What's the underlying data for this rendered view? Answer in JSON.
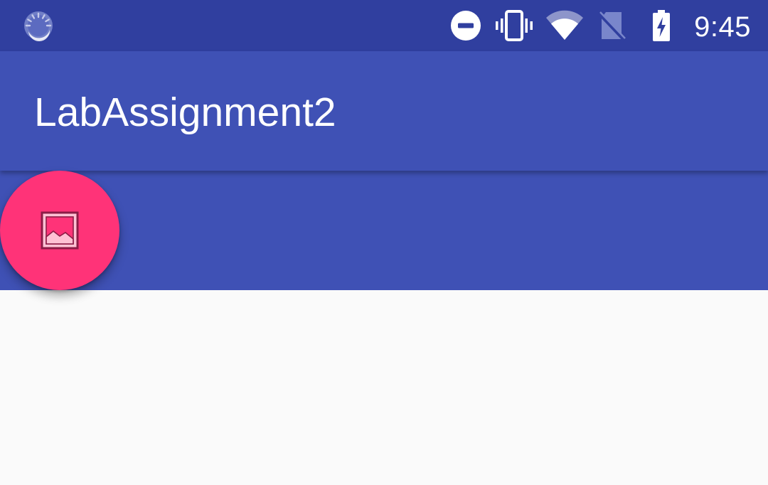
{
  "status_bar": {
    "time": "9:45",
    "icons": [
      "loading-spinner-icon",
      "do-not-disturb-icon",
      "vibrate-icon",
      "wifi-icon",
      "no-sim-icon",
      "battery-charging-icon"
    ]
  },
  "app_bar": {
    "title": "LabAssignment2"
  },
  "fab": {
    "icon": "image-icon"
  },
  "colors": {
    "status_bar": "#303f9f",
    "primary": "#3f51b5",
    "accent": "#ff3378",
    "background": "#fafafa"
  }
}
